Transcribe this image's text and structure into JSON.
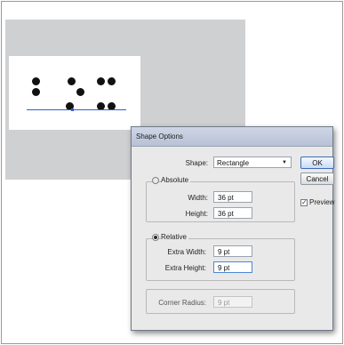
{
  "dialog": {
    "title": "Shape Options",
    "shape": {
      "label": "Shape:",
      "value": "Rectangle"
    },
    "absolute": {
      "label": "Absolute",
      "selected": false,
      "width_label": "Width:",
      "width_value": "36 pt",
      "height_label": "Height:",
      "height_value": "36 pt"
    },
    "relative": {
      "label": "Relative",
      "selected": true,
      "extra_width_label": "Extra Width:",
      "extra_width_value": "9 pt",
      "extra_height_label": "Extra Height:",
      "extra_height_value": "9 pt"
    },
    "corner_radius": {
      "label": "Corner Radius:",
      "value": "9 pt"
    },
    "buttons": {
      "ok": "OK",
      "cancel": "Cancel"
    },
    "preview": {
      "label": "Preview",
      "checked": true,
      "check_glyph": "✓"
    }
  }
}
